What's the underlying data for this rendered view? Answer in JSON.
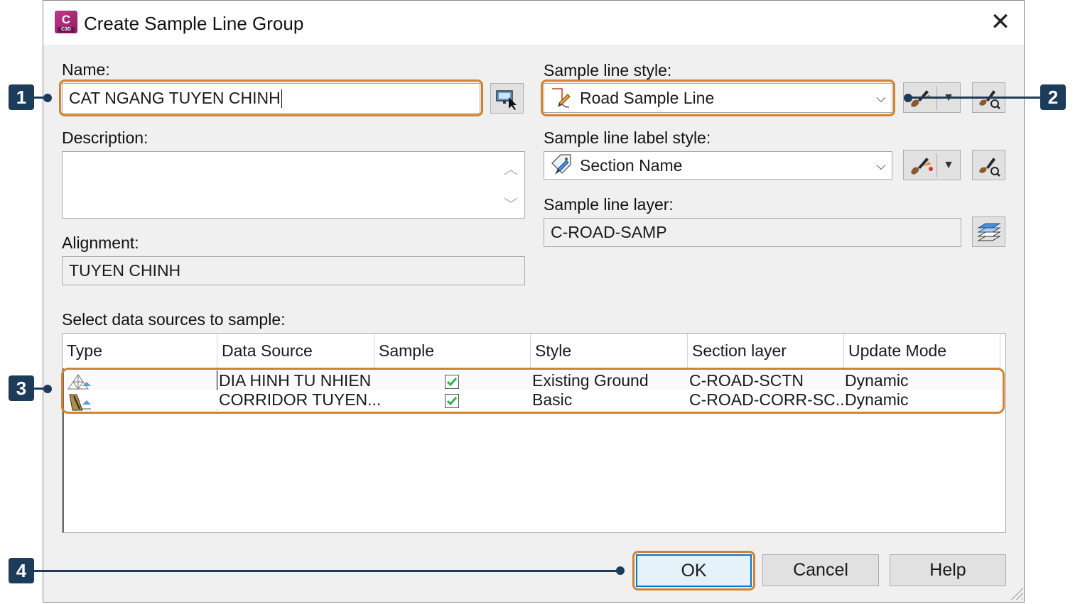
{
  "window": {
    "title": "Create Sample Line Group",
    "app_icon_letter": "C",
    "app_icon_sub": "C3D",
    "close_glyph": "✕"
  },
  "name": {
    "label": "Name:",
    "value": "CAT NGANG TUYEN CHINH"
  },
  "description": {
    "label": "Description:",
    "value": ""
  },
  "alignment": {
    "label": "Alignment:",
    "value": "TUYEN CHINH"
  },
  "sample_line_style": {
    "label": "Sample line style:",
    "selected": "Road Sample Line",
    "icon": "sample-line-style-icon"
  },
  "sample_line_label_style": {
    "label": "Sample line label style:",
    "selected": "Section Name",
    "icon": "label-style-icon"
  },
  "sample_line_layer": {
    "label": "Sample line layer:",
    "value": "C-ROAD-SAMP"
  },
  "data_sources": {
    "label": "Select data sources to sample:",
    "columns": [
      "Type",
      "Data Source",
      "Sample",
      "Style",
      "Section layer",
      "Update Mode"
    ],
    "rows": [
      {
        "type_icon": "surface-icon",
        "source": "DIA HINH TU NHIEN",
        "sample": true,
        "style": "Existing Ground",
        "layer": "C-ROAD-SCTN",
        "mode": "Dynamic"
      },
      {
        "type_icon": "corridor-icon",
        "source": "CORRIDOR TUYEN...",
        "sample": true,
        "style": "Basic",
        "layer": "C-ROAD-CORR-SC...",
        "mode": "Dynamic"
      }
    ]
  },
  "buttons": {
    "ok": "OK",
    "cancel": "Cancel",
    "help": "Help"
  },
  "callouts": [
    "1",
    "2",
    "3",
    "4"
  ],
  "colors": {
    "highlight": "#d2832f",
    "callout": "#1d3b5a",
    "check": "#2bb24c"
  }
}
